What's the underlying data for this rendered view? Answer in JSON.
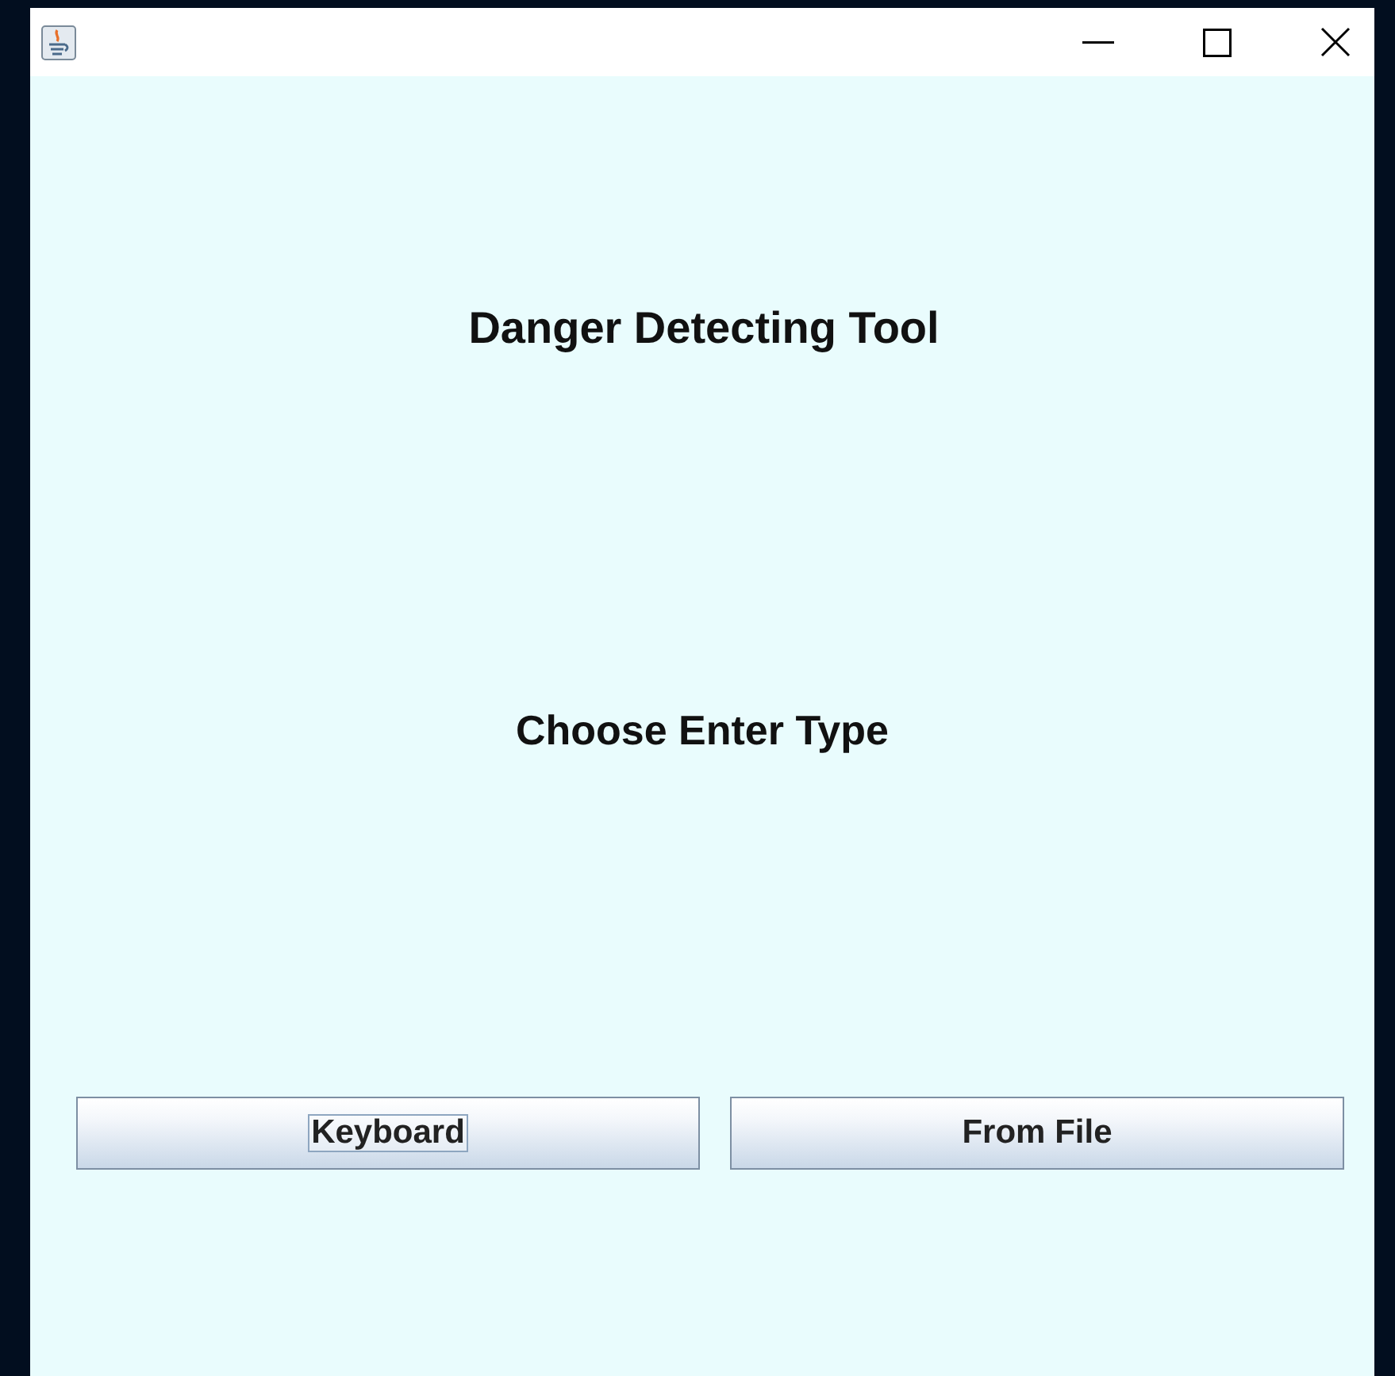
{
  "heading": "Danger Detecting Tool",
  "subheading": "Choose Enter Type",
  "buttons": [
    {
      "label": "Keyboard",
      "focused": true
    },
    {
      "label": "From File",
      "focused": false
    }
  ]
}
